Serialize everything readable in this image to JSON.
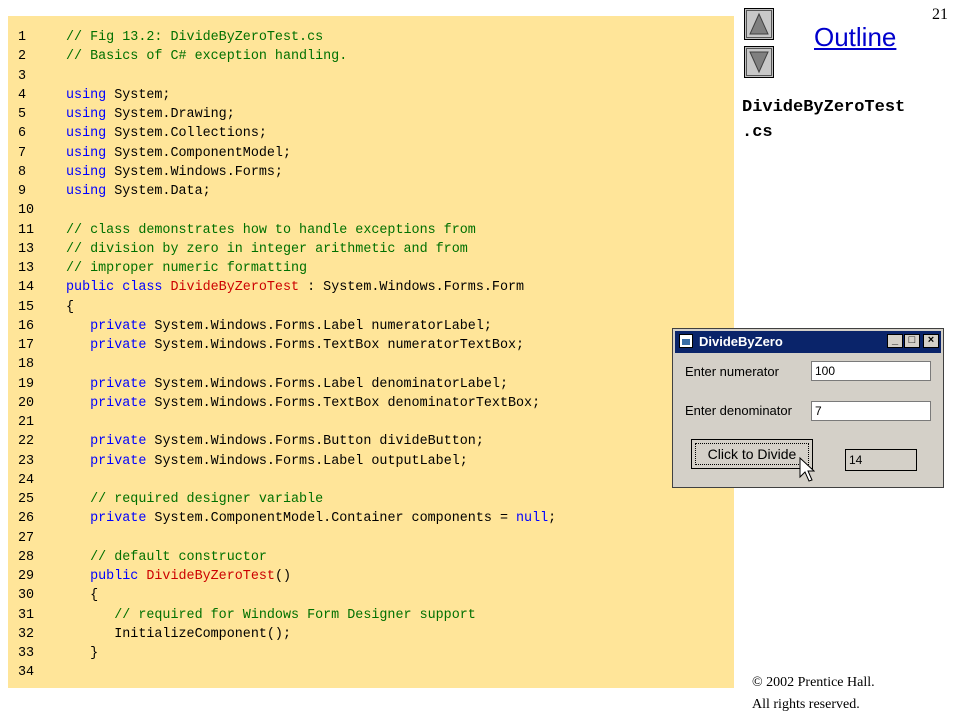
{
  "slide": {
    "page_number": "21",
    "outline_label": "Outline",
    "file_label_line1": "DivideByZeroTest",
    "file_label_line2": ".cs",
    "copyright_line1": "© 2002 Prentice Hall.",
    "copyright_line2": "All rights reserved."
  },
  "nav": {
    "up_icon": "triangle-up-icon",
    "down_icon": "triangle-down-icon"
  },
  "code_lines": [
    {
      "n": "1",
      "parts": [
        [
          "comment",
          "// Fig 13.2: DivideByZeroTest.cs"
        ]
      ]
    },
    {
      "n": "2",
      "parts": [
        [
          "comment",
          "// Basics of C# exception handling."
        ]
      ]
    },
    {
      "n": "3",
      "parts": []
    },
    {
      "n": "4",
      "parts": [
        [
          "kw",
          "using "
        ],
        [
          "txt",
          "System;"
        ]
      ]
    },
    {
      "n": "5",
      "parts": [
        [
          "kw",
          "using "
        ],
        [
          "txt",
          "System.Drawing;"
        ]
      ]
    },
    {
      "n": "6",
      "parts": [
        [
          "kw",
          "using "
        ],
        [
          "txt",
          "System.Collections;"
        ]
      ]
    },
    {
      "n": "7",
      "parts": [
        [
          "kw",
          "using "
        ],
        [
          "txt",
          "System.ComponentModel;"
        ]
      ]
    },
    {
      "n": "8",
      "parts": [
        [
          "kw",
          "using "
        ],
        [
          "txt",
          "System.Windows.Forms;"
        ]
      ]
    },
    {
      "n": "9",
      "parts": [
        [
          "kw",
          "using "
        ],
        [
          "txt",
          "System.Data;"
        ]
      ]
    },
    {
      "n": "10",
      "parts": []
    },
    {
      "n": "11",
      "parts": [
        [
          "comment",
          "// class demonstrates how to handle exceptions from"
        ]
      ]
    },
    {
      "n": "13",
      "parts": [
        [
          "comment",
          "// division by zero in integer arithmetic and from"
        ]
      ]
    },
    {
      "n": "13",
      "parts": [
        [
          "comment",
          "// improper numeric formatting"
        ]
      ]
    },
    {
      "n": "14",
      "parts": [
        [
          "kw",
          "public class "
        ],
        [
          "cls",
          "DivideByZeroTest"
        ],
        [
          "txt",
          " : System.Windows.Forms.Form"
        ]
      ]
    },
    {
      "n": "15",
      "parts": [
        [
          "txt",
          "{"
        ]
      ]
    },
    {
      "n": "16",
      "parts": [
        [
          "kw",
          "   private "
        ],
        [
          "txt",
          "System.Windows.Forms.Label numeratorLabel;"
        ]
      ]
    },
    {
      "n": "17",
      "parts": [
        [
          "kw",
          "   private "
        ],
        [
          "txt",
          "System.Windows.Forms.TextBox numeratorTextBox;"
        ]
      ]
    },
    {
      "n": "18",
      "parts": []
    },
    {
      "n": "19",
      "parts": [
        [
          "kw",
          "   private "
        ],
        [
          "txt",
          "System.Windows.Forms.Label denominatorLabel;"
        ]
      ]
    },
    {
      "n": "20",
      "parts": [
        [
          "kw",
          "   private "
        ],
        [
          "txt",
          "System.Windows.Forms.TextBox denominatorTextBox;"
        ]
      ]
    },
    {
      "n": "21",
      "parts": []
    },
    {
      "n": "22",
      "parts": [
        [
          "kw",
          "   private "
        ],
        [
          "txt",
          "System.Windows.Forms.Button divideButton;"
        ]
      ]
    },
    {
      "n": "23",
      "parts": [
        [
          "kw",
          "   private "
        ],
        [
          "txt",
          "System.Windows.Forms.Label outputLabel;"
        ]
      ]
    },
    {
      "n": "24",
      "parts": []
    },
    {
      "n": "25",
      "parts": [
        [
          "comment",
          "   // required designer variable"
        ]
      ]
    },
    {
      "n": "26",
      "parts": [
        [
          "kw",
          "   private "
        ],
        [
          "txt",
          "System.ComponentModel.Container components = "
        ],
        [
          "kw",
          "null"
        ],
        [
          "txt",
          ";"
        ]
      ]
    },
    {
      "n": "27",
      "parts": []
    },
    {
      "n": "28",
      "parts": [
        [
          "comment",
          "   // default constructor"
        ]
      ]
    },
    {
      "n": "29",
      "parts": [
        [
          "kw",
          "   public "
        ],
        [
          "cls",
          "DivideByZeroTest"
        ],
        [
          "txt",
          "()"
        ]
      ]
    },
    {
      "n": "30",
      "parts": [
        [
          "txt",
          "   {"
        ]
      ]
    },
    {
      "n": "31",
      "parts": [
        [
          "comment",
          "      // required for Windows Form Designer support"
        ]
      ]
    },
    {
      "n": "32",
      "parts": [
        [
          "txt",
          "      InitializeComponent();"
        ]
      ]
    },
    {
      "n": "33",
      "parts": [
        [
          "txt",
          "   }"
        ]
      ]
    },
    {
      "n": "34",
      "parts": []
    }
  ],
  "window": {
    "title": "DivideByZero",
    "minimize_label": "_",
    "maximize_label": "□",
    "close_label": "×",
    "numerator_label": "Enter numerator",
    "numerator_value": "100",
    "denominator_label": "Enter denominator",
    "denominator_value": "7",
    "button_label": "Click to Divide",
    "output_value": "14",
    "cursor_icon": "mouse-cursor-icon"
  }
}
